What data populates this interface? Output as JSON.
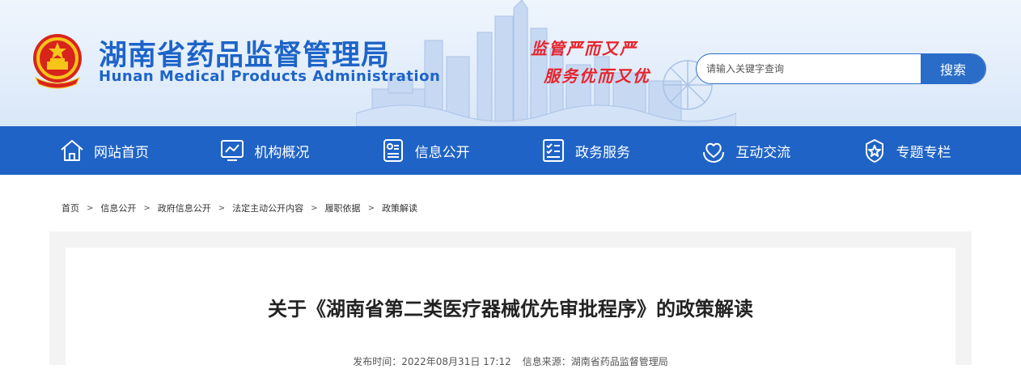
{
  "header": {
    "title": "湖南省药品监督管理局",
    "subtitle": "Hunan Medical Products Administration",
    "slogan_line1": "监管严而又严",
    "slogan_line2": "服务优而又优"
  },
  "search": {
    "placeholder": "请输入关键字查询",
    "button_label": "搜索"
  },
  "nav": {
    "items": [
      {
        "label": "网站首页",
        "icon": "home-icon"
      },
      {
        "label": "机构概况",
        "icon": "monitor-chart-icon"
      },
      {
        "label": "信息公开",
        "icon": "id-card-icon"
      },
      {
        "label": "政务服务",
        "icon": "checklist-icon"
      },
      {
        "label": "互动交流",
        "icon": "heart-hands-icon"
      },
      {
        "label": "专题专栏",
        "icon": "star-badge-icon"
      }
    ]
  },
  "breadcrumb": {
    "items": [
      "首页",
      "信息公开",
      "政府信息公开",
      "法定主动公开内容",
      "履职依据",
      "政策解读"
    ],
    "separator": ">"
  },
  "article": {
    "title": "关于《湖南省第二类医疗器械优先审批程序》的政策解读",
    "publish_label": "发布时间：2022年08月31日 17:12",
    "source_label": "信息来源：湖南省药品监督管理局"
  },
  "colors": {
    "brand_blue": "#1f63c6",
    "slogan_red": "#e8232c",
    "title_blue": "#1d64c8"
  }
}
